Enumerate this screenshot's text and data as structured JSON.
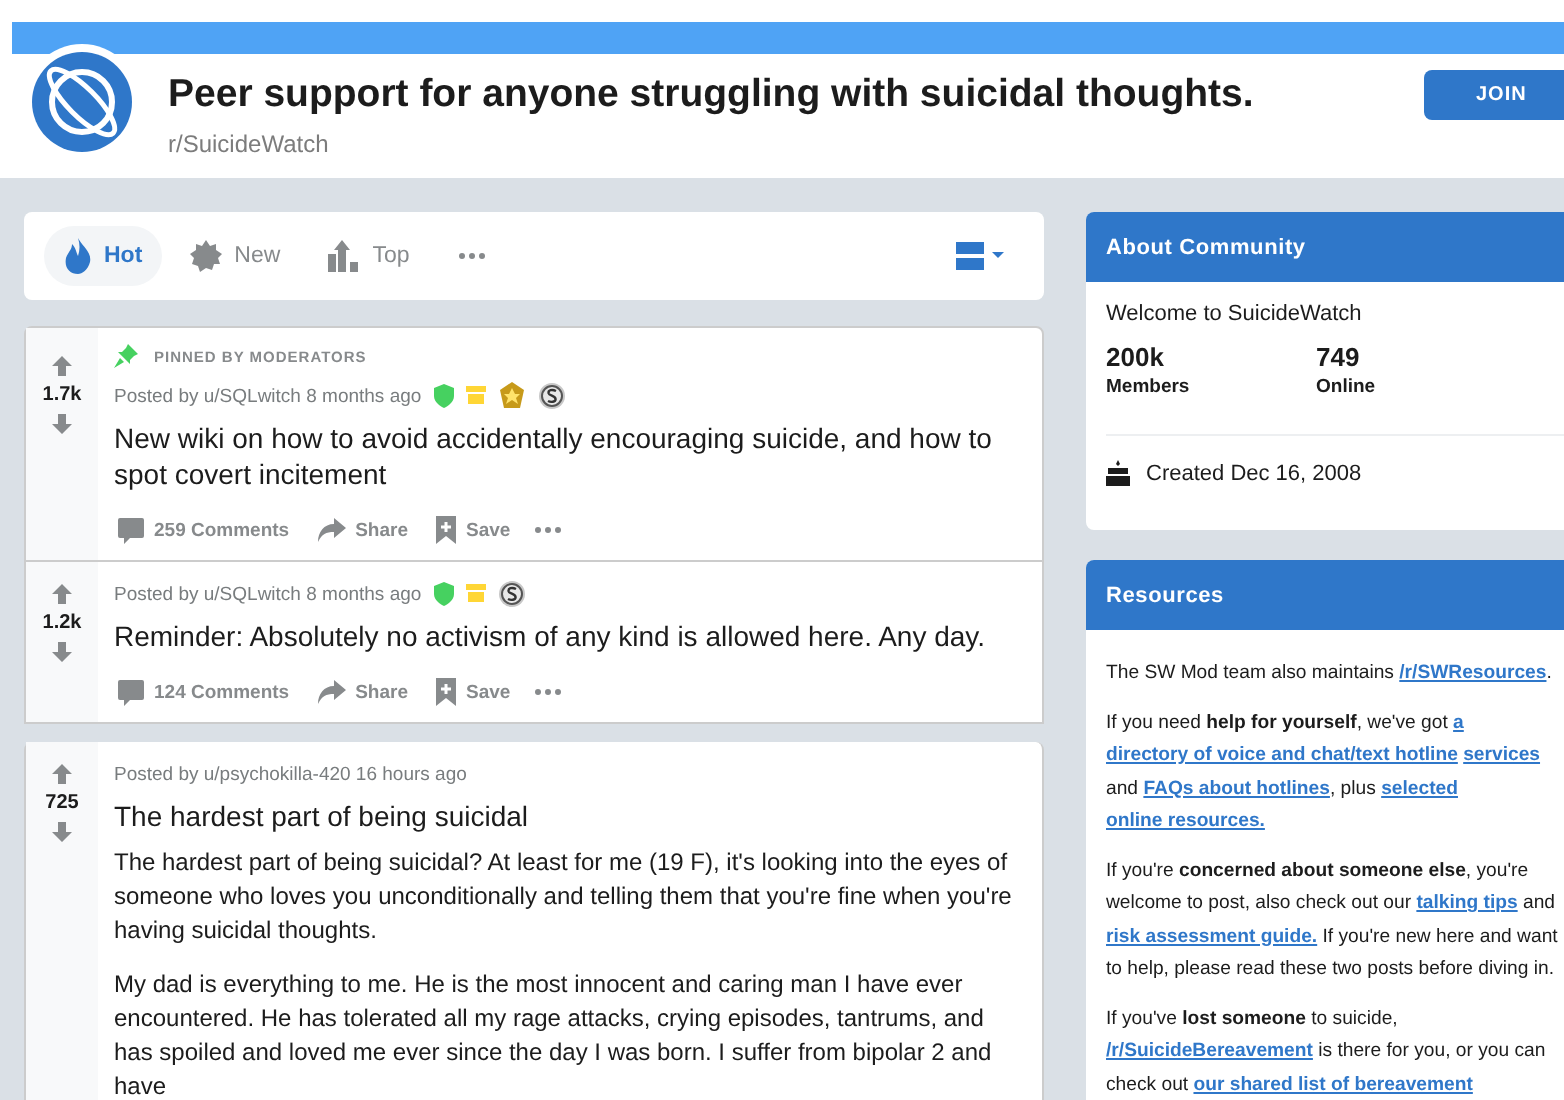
{
  "header": {
    "title": "Peer support for anyone struggling with suicidal thoughts.",
    "subreddit": "r/SuicideWatch",
    "join": "JOIN"
  },
  "sort_tabs": [
    {
      "label": "Hot",
      "kind": "hot",
      "selected": true
    },
    {
      "label": "New",
      "kind": "new",
      "selected": false
    },
    {
      "label": "Top",
      "kind": "top",
      "selected": false
    }
  ],
  "posts": [
    {
      "pinned": true,
      "pinned_label": "PINNED BY MODERATORS",
      "votes": "1.7k",
      "byline": "Posted by u/SQLwitch 8 months ago",
      "awards": [
        {
          "kind": "shield"
        },
        {
          "kind": "archive"
        },
        {
          "kind": "medal"
        },
        {
          "kind": "silver"
        }
      ],
      "title": "New wiki on how to avoid accidentally encouraging suicide, and how to spot covert incitement",
      "comments": "259 Comments",
      "share": "Share",
      "save": "Save"
    },
    {
      "pinned": false,
      "votes": "1.2k",
      "byline": "Posted by u/SQLwitch 8 months ago",
      "awards": [
        {
          "kind": "shield"
        },
        {
          "kind": "archive"
        },
        {
          "kind": "silver"
        }
      ],
      "title": "Reminder: Absolutely no activism of any kind is allowed here. Any day.",
      "comments": "124 Comments",
      "share": "Share",
      "save": "Save"
    },
    {
      "pinned": false,
      "votes": "725",
      "byline": "Posted by u/psychokilla-420 16 hours ago",
      "title": "The hardest part of being suicidal",
      "body": [
        "The hardest part of being suicidal? At least for me (19 F), it's looking into the eyes of someone who loves you unconditionally and telling them that you're fine when you're having suicidal thoughts.",
        "My dad is everything to me. He is the most innocent and caring man I have ever encountered. He has tolerated all my rage attacks, crying episodes, tantrums, and has spoiled and loved me ever since the day I was born. I suffer from bipolar 2 and have"
      ]
    }
  ],
  "about": {
    "title": "About Community",
    "welcome": "Welcome to SuicideWatch",
    "stats": [
      {
        "value": "200k",
        "label": "Members"
      },
      {
        "value": "749",
        "label": "Online"
      }
    ],
    "created": "Created Dec 16, 2008"
  },
  "resources": {
    "title": "Resources",
    "paragraphs": [
      [
        {
          "kind": "text",
          "text": "The SW Mod team also maintains "
        },
        {
          "kind": "link",
          "text": "/r/SWResources"
        },
        {
          "kind": "text",
          "text": "."
        }
      ],
      [
        {
          "kind": "text",
          "text": "If you need "
        },
        {
          "kind": "bold",
          "text": "help for yourself"
        },
        {
          "kind": "text",
          "text": ", we've got "
        },
        {
          "kind": "link",
          "text": "a"
        },
        {
          "kind": "link",
          "text": "directory of voice and chat/text hotline"
        },
        {
          "kind": "link",
          "text": "services"
        },
        {
          "kind": "text",
          "text": " and "
        },
        {
          "kind": "link",
          "text": "FAQs about hotlines"
        },
        {
          "kind": "text",
          "text": ", plus "
        },
        {
          "kind": "link",
          "text": "selected"
        },
        {
          "kind": "link",
          "text": "online resources."
        }
      ],
      [
        {
          "kind": "text",
          "text": "If you're "
        },
        {
          "kind": "bold",
          "text": "concerned about someone else"
        },
        {
          "kind": "text",
          "text": ", you're welcome to post, also check out our "
        },
        {
          "kind": "link",
          "text": "talking tips"
        },
        {
          "kind": "text",
          "text": " and "
        },
        {
          "kind": "link",
          "text": "risk assessment guide."
        },
        {
          "kind": "text",
          "text": " If you're new here and want to help, please read these two posts before diving in."
        }
      ],
      [
        {
          "kind": "text",
          "text": "If you've "
        },
        {
          "kind": "bold",
          "text": "lost someone"
        },
        {
          "kind": "text",
          "text": " to suicide, "
        },
        {
          "kind": "link",
          "text": "/r/SuicideBereavement"
        },
        {
          "kind": "text",
          "text": " is there for you, or you can check out "
        },
        {
          "kind": "link",
          "text": "our shared list of bereavement"
        }
      ]
    ]
  }
}
